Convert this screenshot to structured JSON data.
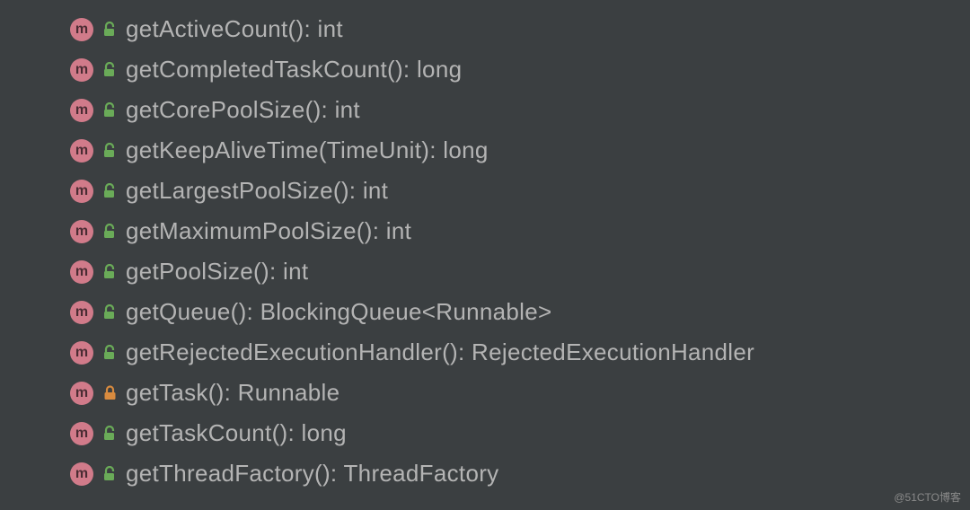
{
  "watermark": "@51CTO博客",
  "methods": [
    {
      "name": "getActiveCount(): int",
      "access": "public"
    },
    {
      "name": "getCompletedTaskCount(): long",
      "access": "public"
    },
    {
      "name": "getCorePoolSize(): int",
      "access": "public"
    },
    {
      "name": "getKeepAliveTime(TimeUnit): long",
      "access": "public"
    },
    {
      "name": "getLargestPoolSize(): int",
      "access": "public"
    },
    {
      "name": "getMaximumPoolSize(): int",
      "access": "public"
    },
    {
      "name": "getPoolSize(): int",
      "access": "public"
    },
    {
      "name": "getQueue(): BlockingQueue<Runnable>",
      "access": "public"
    },
    {
      "name": "getRejectedExecutionHandler(): RejectedExecutionHandler",
      "access": "public"
    },
    {
      "name": "getTask(): Runnable",
      "access": "private"
    },
    {
      "name": "getTaskCount(): long",
      "access": "public"
    },
    {
      "name": "getThreadFactory(): ThreadFactory",
      "access": "public"
    }
  ],
  "icons": {
    "method_letter": "m"
  }
}
